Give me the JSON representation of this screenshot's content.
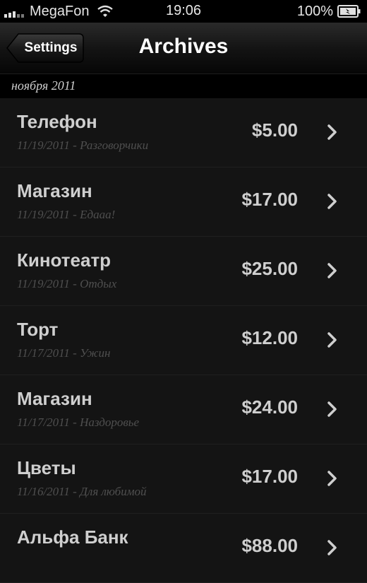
{
  "status_bar": {
    "carrier": "MegaFon",
    "time": "19:06",
    "battery": "100%",
    "signal_bars": 5,
    "icons": [
      "signal-icon",
      "wifi-icon",
      "battery-icon"
    ]
  },
  "nav": {
    "back_label": "Settings",
    "title": "Archives",
    "icons": [
      "back-arrow-icon"
    ]
  },
  "section": {
    "title": "ноября 2011"
  },
  "rows": [
    {
      "title": "Телефон",
      "subtitle": "11/19/2011 - Разговорчики",
      "amount": "$5.00"
    },
    {
      "title": "Магазин",
      "subtitle": "11/19/2011 - Едааа!",
      "amount": "$17.00"
    },
    {
      "title": "Кинотеатр",
      "subtitle": "11/19/2011 - Отдых",
      "amount": "$25.00"
    },
    {
      "title": "Торт",
      "subtitle": "11/17/2011 - Ужин",
      "amount": "$12.00"
    },
    {
      "title": "Магазин",
      "subtitle": "11/17/2011 - Наздоровье",
      "amount": "$24.00"
    },
    {
      "title": "Цветы",
      "subtitle": "11/16/2011 - Для любимой",
      "amount": "$17.00"
    },
    {
      "title": "Альфа Банк",
      "subtitle": "",
      "amount": "$88.00"
    }
  ],
  "colors": {
    "background": "#000000",
    "row_background": "#141414",
    "row_text": "#cfcfcf",
    "row_subtitle": "#4f4f4f"
  }
}
